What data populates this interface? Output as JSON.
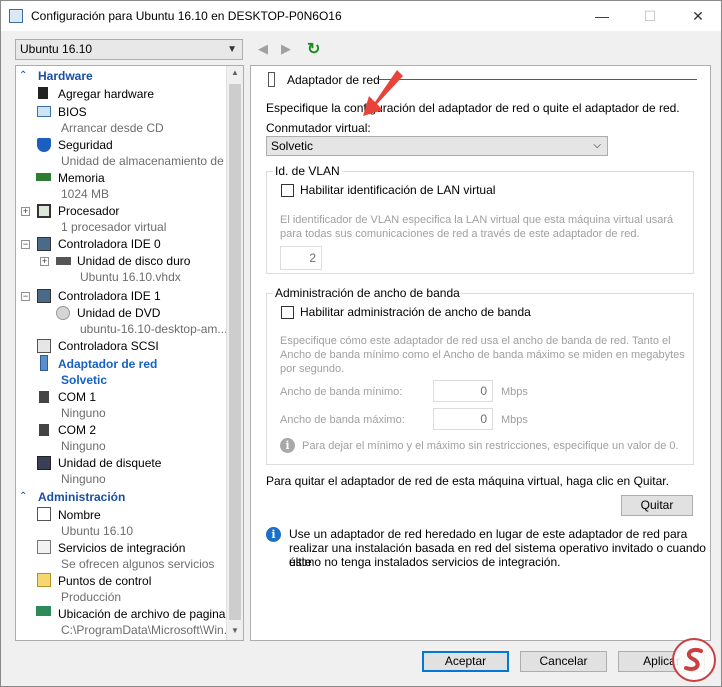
{
  "window": {
    "title": "Configuración para Ubuntu 16.10 en DESKTOP-P0N6O16",
    "minimize": "—",
    "maximize": "☐",
    "close": "✕"
  },
  "vm_selector": {
    "value": "Ubuntu 16.10"
  },
  "tree": {
    "sections": {
      "hardware": "Hardware",
      "administracion": "Administración"
    },
    "items": [
      {
        "label": "Agregar hardware",
        "sub": ""
      },
      {
        "label": "BIOS",
        "sub": "Arrancar desde CD"
      },
      {
        "label": "Seguridad",
        "sub": "Unidad de almacenamiento de ..."
      },
      {
        "label": "Memoria",
        "sub": "1024 MB"
      },
      {
        "label": "Procesador",
        "sub": "1 procesador virtual"
      },
      {
        "label": "Controladora IDE 0",
        "sub": ""
      },
      {
        "label": "Unidad de disco duro",
        "sub": "Ubuntu 16.10.vhdx"
      },
      {
        "label": "Controladora IDE 1",
        "sub": ""
      },
      {
        "label": "Unidad de DVD",
        "sub": "ubuntu-16.10-desktop-am..."
      },
      {
        "label": "Controladora SCSI",
        "sub": ""
      },
      {
        "label": "Adaptador de red",
        "sub": "Solvetic"
      },
      {
        "label": "COM 1",
        "sub": "Ninguno"
      },
      {
        "label": "COM 2",
        "sub": "Ninguno"
      },
      {
        "label": "Unidad de disquete",
        "sub": "Ninguno"
      }
    ],
    "admin_items": [
      {
        "label": "Nombre",
        "sub": "Ubuntu 16.10"
      },
      {
        "label": "Servicios de integración",
        "sub": "Se ofrecen algunos servicios"
      },
      {
        "label": "Puntos de control",
        "sub": "Producción"
      },
      {
        "label": "Ubicación de archivo de paginac...",
        "sub": "C:\\ProgramData\\Microsoft\\Win..."
      }
    ]
  },
  "panel": {
    "title": "Adaptador de red",
    "description": "Especifique la configuración del adaptador de red o quite el adaptador de red.",
    "switch_label": "Conmutador virtual:",
    "switch_value": "Solvetic",
    "vlan": {
      "group_label": "Id. de VLAN",
      "checkbox_label": "Habilitar identificación de LAN virtual",
      "help_line1": "El identificador de VLAN especifica la LAN virtual que esta máquina virtual usará",
      "help_line2": "para todas sus comunicaciones de red a través de este adaptador de red.",
      "value": "2"
    },
    "bandwidth": {
      "group_label": "Administración de ancho de banda",
      "checkbox_label": "Habilitar administración de ancho de banda",
      "help_line1": "Especifique cómo este adaptador de red usa el ancho de banda de red. Tanto el",
      "help_line2": "Ancho de banda mínimo como el Ancho de banda máximo se miden en megabytes",
      "help_line3": "por segundo.",
      "min_label": "Ancho de banda mínimo:",
      "min_value": "0",
      "max_label": "Ancho de banda máximo:",
      "max_value": "0",
      "unit": "Mbps",
      "info": "Para dejar el mínimo y el máximo sin restricciones, especifique un valor de 0."
    },
    "remove_text": "Para quitar el adaptador de red de esta máquina virtual, haga clic en Quitar.",
    "remove_button": "Quitar",
    "info_line1": "Use un adaptador de red heredado en lugar de este adaptador de red para",
    "info_line2": "realizar una instalación basada en red del sistema operativo invitado o cuando este",
    "info_line3": "último no tenga instalados servicios de integración."
  },
  "buttons": {
    "accept": "Aceptar",
    "cancel": "Cancelar",
    "apply": "Aplicar"
  },
  "colors": {
    "accent": "#0078d7",
    "section_header": "#1b4fa0",
    "selected_item": "#1561c4",
    "arrow": "#e8433b"
  }
}
